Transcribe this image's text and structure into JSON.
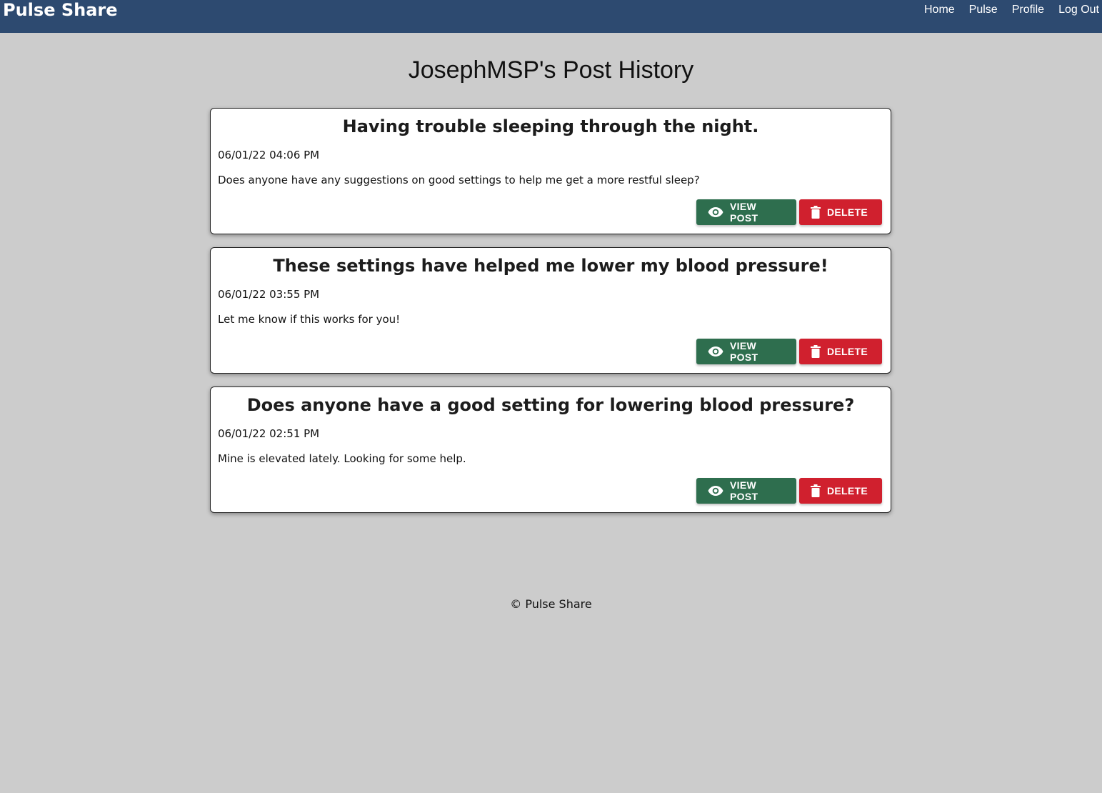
{
  "header": {
    "brand": "Pulse Share",
    "nav": [
      {
        "label": "Home"
      },
      {
        "label": "Pulse"
      },
      {
        "label": "Profile"
      },
      {
        "label": "Log Out"
      }
    ],
    "background_color": "#2d4a70"
  },
  "main": {
    "title": "JosephMSP's Post History",
    "posts": [
      {
        "title": "Having trouble sleeping through the night.",
        "date": "06/01/22 04:06 PM",
        "body": "Does anyone have any suggestions on good settings to help me get a more restful sleep?",
        "view_label": "VIEW POST",
        "delete_label": "DELETE"
      },
      {
        "title": "These settings have helped me lower my blood pressure!",
        "date": "06/01/22 03:55 PM",
        "body": "Let me know if this works for you!",
        "view_label": "VIEW POST",
        "delete_label": "DELETE"
      },
      {
        "title": "Does anyone have a good setting for lowering blood pressure?",
        "date": "06/01/22 02:51 PM",
        "body": "Mine is elevated lately. Looking for some help.",
        "view_label": "VIEW POST",
        "delete_label": "DELETE"
      }
    ],
    "icons": {
      "view": "eye-icon",
      "delete": "trash-icon"
    },
    "colors": {
      "view_button": "#2e6e4e",
      "delete_button": "#d0202e",
      "page_background": "#cccccc"
    }
  },
  "footer": {
    "text": "© Pulse Share"
  }
}
